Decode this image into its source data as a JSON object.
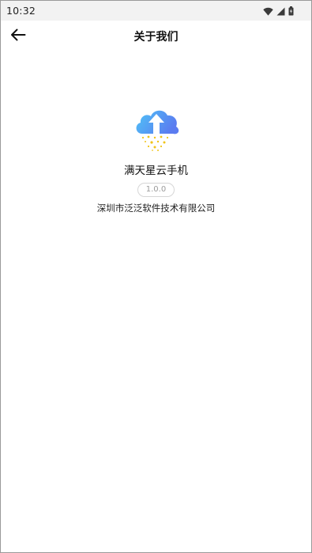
{
  "status_bar": {
    "time": "10:32",
    "icons": [
      "wifi-icon",
      "signal-icon",
      "battery-icon"
    ]
  },
  "app_bar": {
    "back_icon": "arrow-left-icon",
    "title": "关于我们"
  },
  "about": {
    "logo_icon": "cloud-upload-stars-icon",
    "app_name": "满天星云手机",
    "version": "1.0.0",
    "company": "深圳市泛泛软件技术有限公司"
  },
  "colors": {
    "logo_gradient_start": "#4fc3f7",
    "logo_gradient_end": "#5b7cf0",
    "stars": "#f0c419",
    "status_bar_bg": "#f2f2f2",
    "version_text": "#9b9b9b"
  }
}
